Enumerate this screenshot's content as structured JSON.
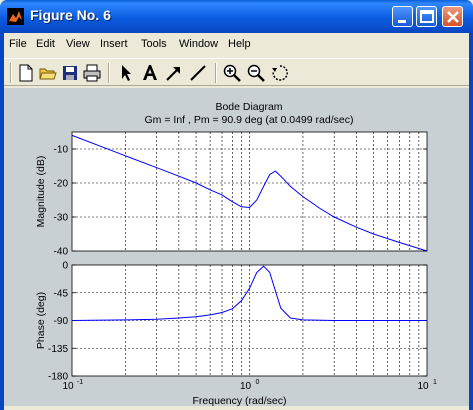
{
  "window": {
    "title": "Figure No. 6"
  },
  "menu": {
    "items": [
      {
        "label": "File"
      },
      {
        "label": "Edit"
      },
      {
        "label": "View"
      },
      {
        "label": "Insert"
      },
      {
        "label": "Tools"
      },
      {
        "label": "Window"
      },
      {
        "label": "Help"
      }
    ]
  },
  "toolbar": {
    "icons": [
      "new-file-icon",
      "open-folder-icon",
      "save-icon",
      "print-icon",
      "select-arrow-icon",
      "insert-text-icon",
      "insert-arrow-icon",
      "insert-line-icon",
      "zoom-in-icon",
      "zoom-out-icon",
      "rotate-icon"
    ]
  },
  "figure": {
    "title": "Bode Diagram",
    "subtitle": "Gm = Inf ,  Pm = 90.9 deg (at 0.0499 rad/sec)"
  },
  "colors": {
    "line": "#0000ff",
    "axes_bg": "#ffffff",
    "figure_bg": "#c8d0d4",
    "grid": "#000000"
  },
  "chart_data": [
    {
      "type": "line",
      "name": "magnitude",
      "ylabel": "Magnitude (dB)",
      "xscale": "log",
      "xlim": [
        0.1,
        10
      ],
      "ylim": [
        -40,
        -5
      ],
      "yticks": [
        -10,
        -20,
        -30,
        -40
      ],
      "ytick_labels": [
        "-10",
        "-20",
        "-30",
        "-40"
      ],
      "grid": true,
      "x": [
        0.1,
        0.15,
        0.2,
        0.3,
        0.4,
        0.5,
        0.6,
        0.7,
        0.8,
        0.9,
        1.0,
        1.1,
        1.2,
        1.3,
        1.4,
        1.5,
        1.7,
        2.0,
        2.5,
        3.0,
        4.0,
        5.0,
        7.0,
        10.0
      ],
      "y": [
        -6,
        -9.5,
        -12,
        -15.5,
        -18,
        -20,
        -22,
        -23.5,
        -25.5,
        -27,
        -27.2,
        -25,
        -21,
        -17.5,
        -16.5,
        -18,
        -21,
        -24,
        -27.5,
        -30,
        -33,
        -35,
        -37.5,
        -40
      ]
    },
    {
      "type": "line",
      "name": "phase",
      "ylabel": "Phase (deg)",
      "xlabel": "Frequency  (rad/sec)",
      "xscale": "log",
      "xlim": [
        0.1,
        10
      ],
      "ylim": [
        -180,
        0
      ],
      "yticks": [
        0,
        -45,
        -90,
        -135,
        -180
      ],
      "ytick_labels": [
        "0",
        "-45",
        "-90",
        "-135",
        "-180"
      ],
      "xticks": [
        0.1,
        1,
        10
      ],
      "xtick_labels": [
        "10^-1",
        "10^0",
        "10^1"
      ],
      "grid": true,
      "x": [
        0.1,
        0.2,
        0.3,
        0.4,
        0.5,
        0.6,
        0.7,
        0.8,
        0.9,
        1.0,
        1.1,
        1.2,
        1.3,
        1.4,
        1.5,
        1.7,
        2.0,
        3.0,
        5.0,
        10.0
      ],
      "y": [
        -90,
        -89,
        -88,
        -86,
        -84,
        -81,
        -77,
        -71,
        -58,
        -38,
        -12,
        -2,
        -12,
        -42,
        -70,
        -86,
        -89,
        -90,
        -90,
        -90
      ]
    }
  ]
}
